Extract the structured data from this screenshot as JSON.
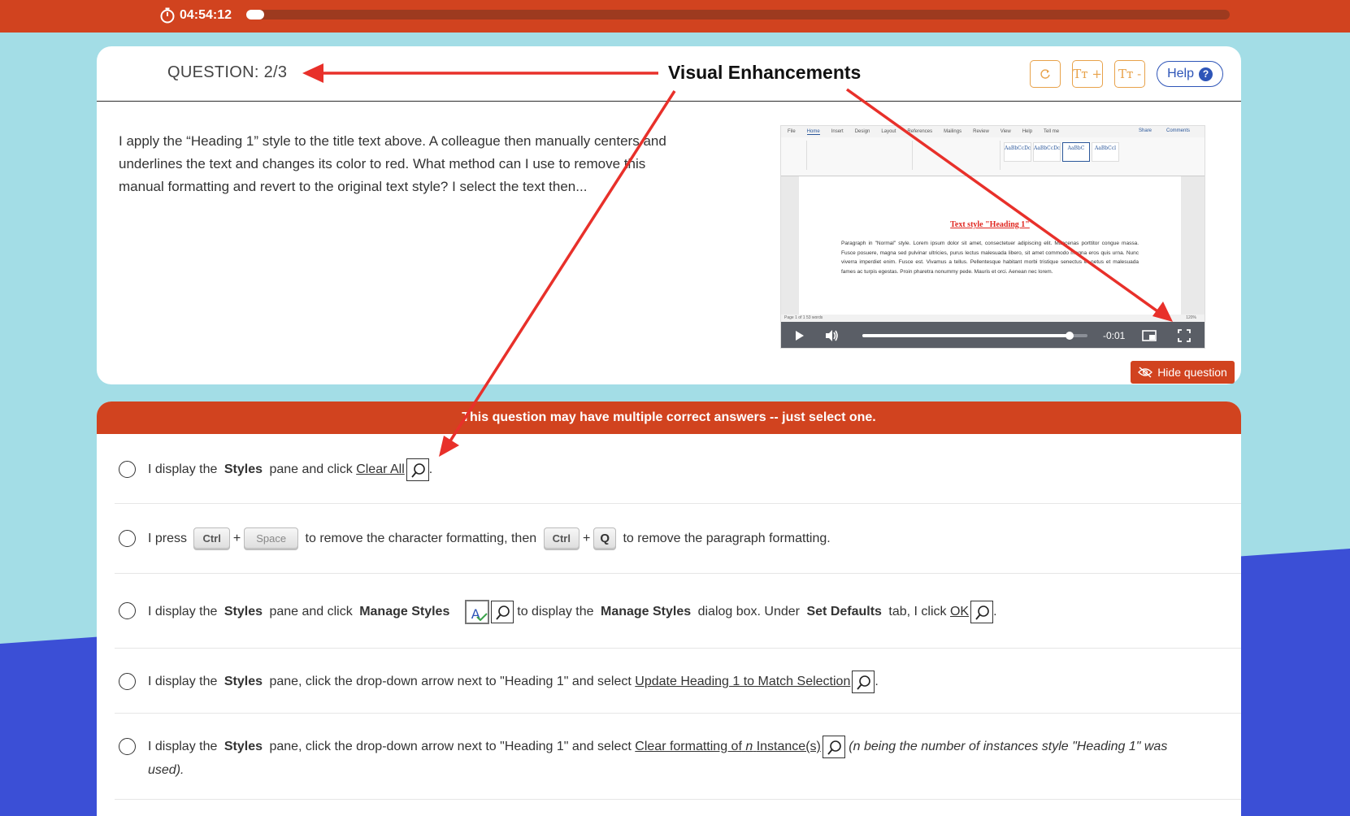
{
  "timer": {
    "value": "04:54:12",
    "progress_fraction": 0.018
  },
  "question": {
    "label": "QUESTION: 2/3",
    "text": "I apply the “Heading 1” style to the title text above. A colleague then manually centers and underlines the text and changes its color to red. What method can I use to remove this manual formatting and revert to the original text style? I select the text then...",
    "hide_label": "Hide question"
  },
  "toolbar": {
    "reset_icon": "refresh-icon",
    "font_increase": "Tт +",
    "font_decrease": "Tт -",
    "help_label": "Help",
    "help_icon": "?"
  },
  "video": {
    "ribbon_tabs": [
      "File",
      "Home",
      "Insert",
      "Design",
      "Layout",
      "References",
      "Mailings",
      "Review",
      "View",
      "Help",
      "Tell me"
    ],
    "share": "Share",
    "comments": "Comments",
    "style_samples": [
      "AaBbCcDc",
      "AaBbCcDc",
      "AaBbC",
      "AaBbCcl"
    ],
    "doc_heading": "Text style \"Heading 1\"",
    "doc_paragraph": "Paragraph in \"Normal\" style. Lorem ipsum dolor sit amet, consectetuer adipiscing elit. Maecenas porttitor congue massa. Fusce posuere, magna sed pulvinar ultricies, purus lectus malesuada libero, sit amet commodo magna eros quis urna. Nunc viverra imperdiet enim. Fusce est. Vivamus a tellus. Pellentesque habitant morbi tristique senectus et netus et malesuada fames ac turpis egestas. Proin pharetra nonummy pede. Mauris et orci. Aenean nec lorem.",
    "status_left": "Page 1 of 1    53 words",
    "status_right": "120%",
    "time_remaining": "-0:01",
    "progress_fraction": 0.92
  },
  "answers": {
    "banner": "This question may have multiple correct answers -- just select one.",
    "options": [
      {
        "pre": "I display the",
        "b1": "Styles",
        "mid": "pane and click",
        "link": "Clear All",
        "post": "."
      },
      {
        "pre": "I press",
        "k1": "Ctrl",
        "plus": "+",
        "k2": "Space",
        "mid": "to remove the character formatting, then",
        "k3": "Ctrl",
        "k4": "Q",
        "post": "to remove the paragraph formatting."
      },
      {
        "pre": "I display the",
        "b1": "Styles",
        "mid": "pane and click",
        "b2": "Manage Styles",
        "mid2": "to display the",
        "b3": "Manage Styles",
        "mid3": "dialog box. Under",
        "b4": "Set Defaults",
        "mid4": "tab, I click",
        "link": "OK",
        "post": "."
      },
      {
        "pre": "I display the",
        "b1": "Styles",
        "mid": "pane, click the drop-down arrow next to \"Heading 1\" and select",
        "link": "Update Heading 1 to Match Selection",
        "post": "."
      },
      {
        "pre": "I display the",
        "b1": "Styles",
        "mid": "pane, click the drop-down arrow next to \"Heading 1\" and select",
        "link_a": "Clear formatting of",
        "link_n": "n",
        "link_b": "Instance(s)",
        "note_line1": "(n being the number of instances style \"Heading 1\" was",
        "note_line2": "used)."
      }
    ]
  },
  "annotation": {
    "label": "Visual Enhancements"
  },
  "colors": {
    "accent": "#d1431f",
    "bg_light": "#a3dde6",
    "bg_blue": "#3b4fd6",
    "help": "#2e55b8",
    "tool": "#e8a24a"
  }
}
